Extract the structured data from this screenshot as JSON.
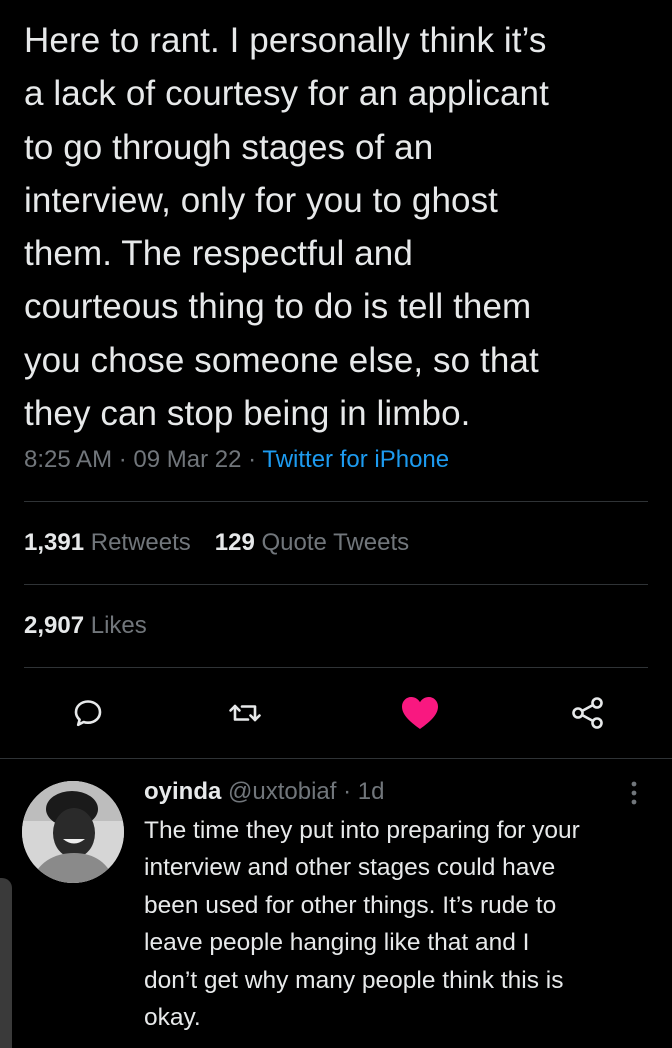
{
  "tweet": {
    "text": "Here to rant. I personally think it’s\na lack of courtesy for an applicant\nto go through stages of an\ninterview, only for you to ghost\nthem. The respectful and\ncourteous thing to do is tell them\nyou chose someone else, so that\nthey can stop being in limbo.",
    "time": "8:25 AM",
    "date": "09 Mar 22",
    "separator": "·",
    "source": "Twitter for iPhone"
  },
  "stats": {
    "retweets_count": "1,391",
    "retweets_label": "Retweets",
    "quotes_count": "129",
    "quotes_label": "Quote Tweets",
    "likes_count": "2,907",
    "likes_label": "Likes"
  },
  "actions": [
    {
      "name": "reply",
      "icon": "reply-icon"
    },
    {
      "name": "retweet",
      "icon": "retweet-icon"
    },
    {
      "name": "like",
      "icon": "heart-icon",
      "state": "liked"
    },
    {
      "name": "share",
      "icon": "share-icon"
    }
  ],
  "reply": {
    "name": "oyinda",
    "handle": "@uxtobiaf",
    "separator": "·",
    "age": "1d",
    "text": "The time they put into preparing for your\ninterview and other stages could have\nbeen used for other things. It’s rude to\nleave people hanging like that and I\ndon’t get why many people think this is\nokay.",
    "more_icon": "more-vertical-icon"
  },
  "colors": {
    "background": "#000000",
    "text": "#e7e9ea",
    "muted": "#71767b",
    "link": "#1d9bf0",
    "like": "#f91880",
    "divider": "#2f3336"
  }
}
